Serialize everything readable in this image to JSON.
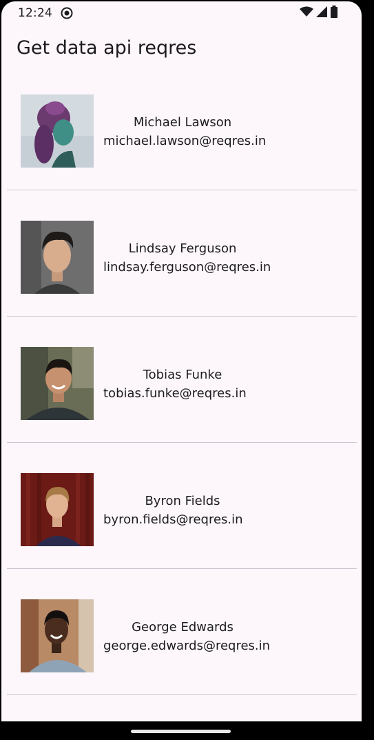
{
  "status_bar": {
    "time": "12:24",
    "icons": [
      "app-notification-icon",
      "wifi-icon",
      "cellular-signal-icon",
      "battery-icon"
    ]
  },
  "app_bar": {
    "title": "Get data api reqres"
  },
  "users": [
    {
      "name": "Michael Lawson",
      "email": "michael.lawson@reqres.in",
      "avatar": "avatar-photo"
    },
    {
      "name": "Lindsay Ferguson",
      "email": "lindsay.ferguson@reqres.in",
      "avatar": "avatar-photo"
    },
    {
      "name": "Tobias Funke",
      "email": "tobias.funke@reqres.in",
      "avatar": "avatar-photo"
    },
    {
      "name": "Byron Fields",
      "email": "byron.fields@reqres.in",
      "avatar": "avatar-photo"
    },
    {
      "name": "George Edwards",
      "email": "george.edwards@reqres.in",
      "avatar": "avatar-photo"
    }
  ],
  "colors": {
    "background": "#fdf7fb",
    "text": "#1c1b1f",
    "divider": "#cac4d0"
  }
}
